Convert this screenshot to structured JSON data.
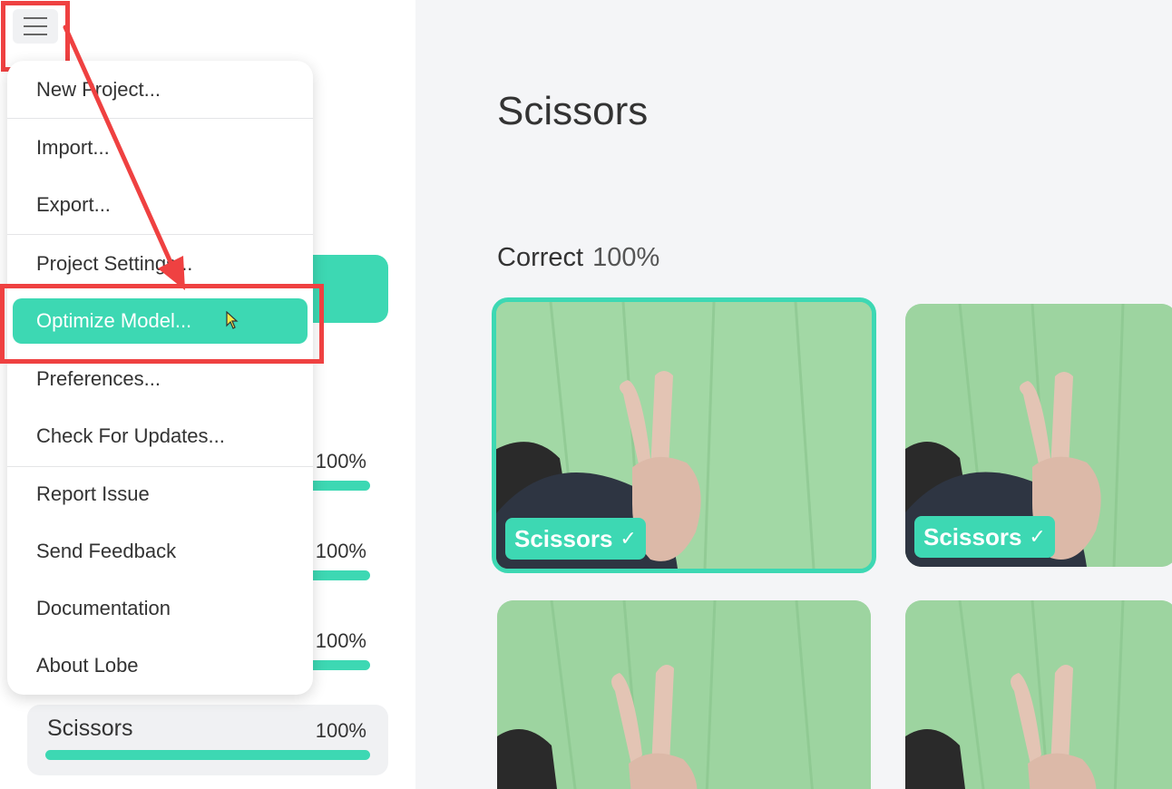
{
  "menu": {
    "items": [
      {
        "label": "New Project..."
      },
      {
        "label": "Import..."
      },
      {
        "label": "Export..."
      },
      {
        "label": "Project Settings..."
      },
      {
        "label": "Optimize Model..."
      },
      {
        "label": "Preferences..."
      },
      {
        "label": "Check For Updates..."
      },
      {
        "label": "Report Issue"
      },
      {
        "label": "Send Feedback"
      },
      {
        "label": "Documentation"
      },
      {
        "label": "About Lobe"
      }
    ]
  },
  "sidebar": {
    "labels": [
      {
        "name": "",
        "percent": "100%"
      },
      {
        "name": "",
        "percent": "100%"
      },
      {
        "name": "",
        "percent": "100%"
      },
      {
        "name": "Scissors",
        "percent": "100%"
      }
    ]
  },
  "main": {
    "title": "Scissors",
    "section": {
      "label": "Correct",
      "percent": "100%"
    },
    "cards": [
      {
        "tag": "Scissors",
        "check": "✓"
      },
      {
        "tag": "Scissors",
        "check": "✓"
      },
      {
        "tag": "",
        "check": ""
      },
      {
        "tag": "",
        "check": ""
      }
    ]
  },
  "colors": {
    "accent": "#3dd8b3",
    "highlight": "#ef4141",
    "background": "#f4f5f7"
  }
}
